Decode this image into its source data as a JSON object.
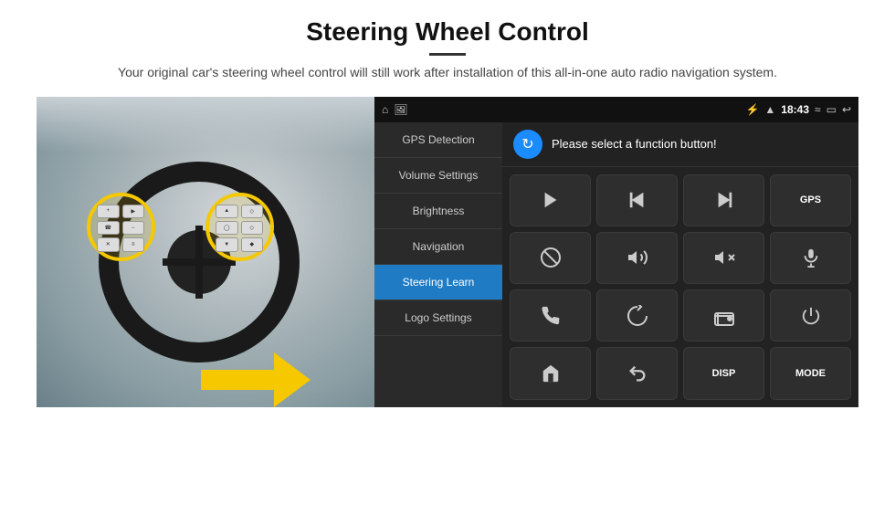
{
  "header": {
    "title": "Steering Wheel Control",
    "divider": true,
    "subtitle": "Your original car's steering wheel control will still work after installation of this all-in-one auto radio navigation system."
  },
  "status_bar": {
    "time": "18:43",
    "icons_left": [
      "home",
      "image"
    ],
    "icons_right": [
      "bluetooth",
      "wifi",
      "signal",
      "arrow-up",
      "battery",
      "back"
    ]
  },
  "menu": {
    "items": [
      {
        "label": "GPS Detection",
        "active": false
      },
      {
        "label": "Volume Settings",
        "active": false
      },
      {
        "label": "Brightness",
        "active": false
      },
      {
        "label": "Navigation",
        "active": false
      },
      {
        "label": "Steering Learn",
        "active": true
      },
      {
        "label": "Logo Settings",
        "active": false
      }
    ]
  },
  "function_panel": {
    "header_text": "Please select a function button!",
    "buttons": [
      {
        "type": "icon",
        "icon": "play"
      },
      {
        "type": "icon",
        "icon": "skip-back"
      },
      {
        "type": "icon",
        "icon": "skip-forward"
      },
      {
        "type": "text",
        "label": "GPS"
      },
      {
        "type": "icon",
        "icon": "no-music"
      },
      {
        "type": "icon",
        "icon": "volume-up"
      },
      {
        "type": "icon",
        "icon": "volume-down"
      },
      {
        "type": "icon",
        "icon": "mic"
      },
      {
        "type": "icon",
        "icon": "phone"
      },
      {
        "type": "icon",
        "icon": "rotate"
      },
      {
        "type": "icon",
        "icon": "radio"
      },
      {
        "type": "icon",
        "icon": "power"
      },
      {
        "type": "icon",
        "icon": "home"
      },
      {
        "type": "icon",
        "icon": "undo"
      },
      {
        "type": "text",
        "label": "DISP"
      },
      {
        "type": "text",
        "label": "MODE"
      }
    ]
  }
}
